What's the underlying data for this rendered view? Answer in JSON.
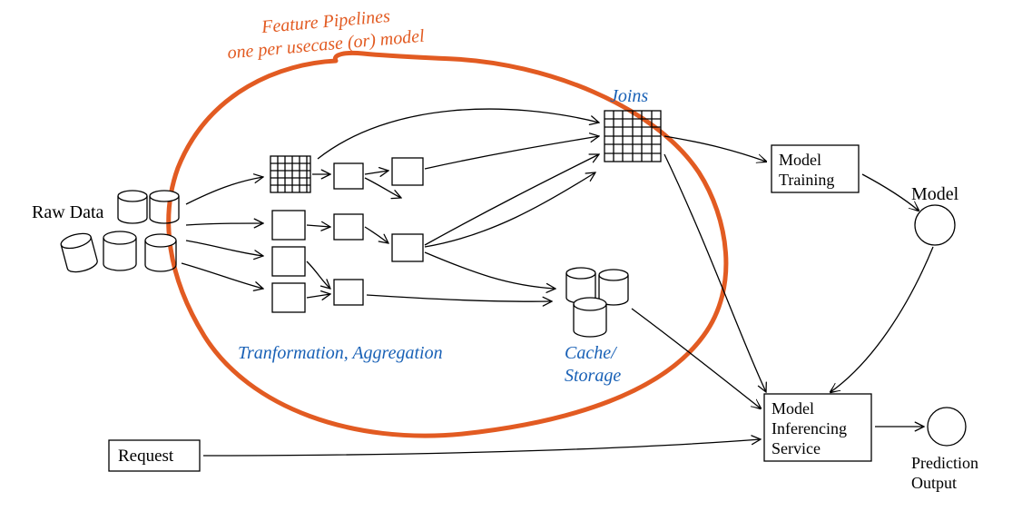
{
  "labels": {
    "raw_data": "Raw Data",
    "feature_pipelines_1": "Feature Pipelines",
    "feature_pipelines_2": "one per usecase (or) model",
    "transformation": "Tranformation, Aggregation",
    "joins": "Joins",
    "cache": "Cache/",
    "cache_2": "Storage",
    "model_training": "Model",
    "model_training_2": "Training",
    "model": "Model",
    "model_inferencing": "Model",
    "model_inferencing_2": "Inferencing",
    "model_inferencing_3": "Service",
    "request": "Request",
    "prediction": "Prediction",
    "prediction_2": "Output"
  }
}
